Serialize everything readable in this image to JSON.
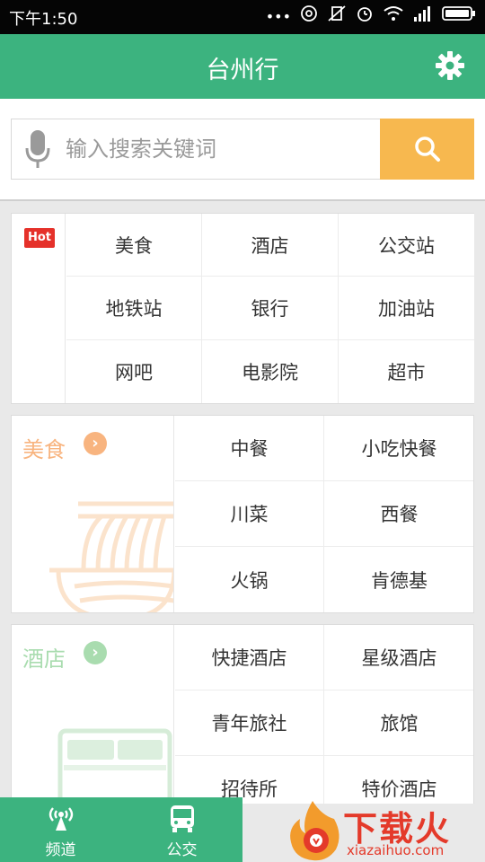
{
  "status_bar": {
    "time": "下午1:50",
    "icons": [
      "more-dots-icon",
      "hotspot-icon",
      "vibrate-off-icon",
      "alarm-icon",
      "wifi-icon",
      "signal-icon",
      "battery-icon"
    ]
  },
  "app_bar": {
    "title": "台州行",
    "settings_icon": "gear-icon"
  },
  "search": {
    "placeholder": "输入搜索关键词",
    "mic_icon": "microphone-icon",
    "button_icon": "search-icon"
  },
  "hot": {
    "badge": "Hot",
    "items": [
      "美食",
      "酒店",
      "公交站",
      "地铁站",
      "银行",
      "加油站",
      "网吧",
      "电影院",
      "超市"
    ]
  },
  "categories": {
    "food": {
      "name": "美食",
      "arrow": "›",
      "items": [
        "中餐",
        "小吃快餐",
        "川菜",
        "西餐",
        "火锅",
        "肯德基"
      ]
    },
    "hotel": {
      "name": "酒店",
      "arrow": "›",
      "items": [
        "快捷酒店",
        "星级酒店",
        "青年旅社",
        "旅馆",
        "招待所",
        "特价酒店"
      ]
    }
  },
  "bottom_nav": [
    {
      "label": "频道",
      "icon": "antenna-icon"
    },
    {
      "label": "公交",
      "icon": "bus-icon"
    }
  ],
  "watermark": {
    "text": "下载火",
    "url": "xiazaihuo.com"
  },
  "colors": {
    "primary": "#3cb37f",
    "search_button": "#f7b84f",
    "hot_badge": "#e5312a",
    "food_accent": "#f8b47f",
    "hotel_accent": "#a9dcaf"
  }
}
